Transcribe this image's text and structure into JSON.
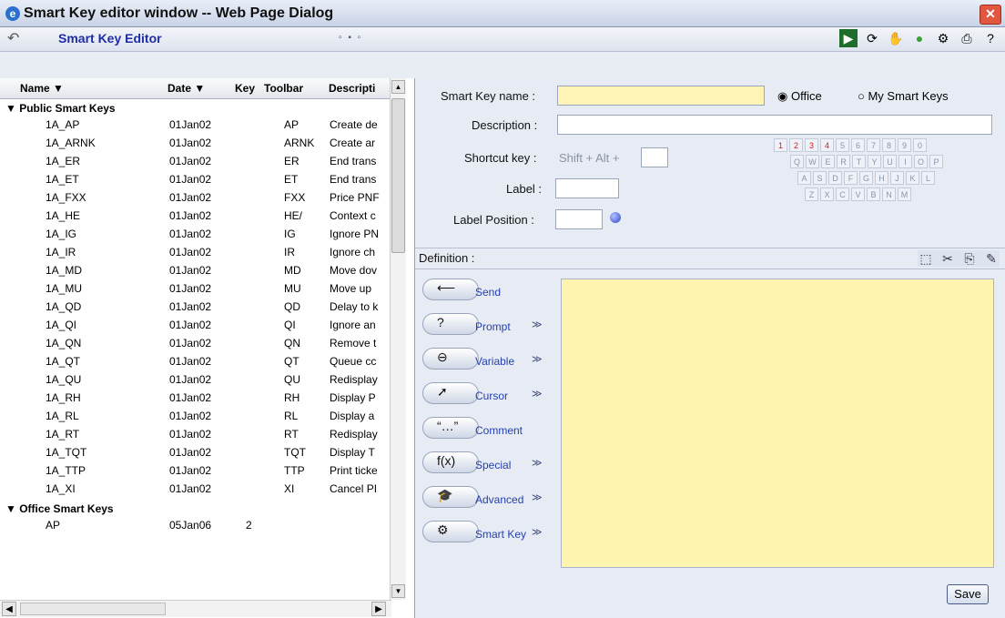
{
  "window": {
    "title": "Smart Key editor window -- Web Page Dialog",
    "close": "✕"
  },
  "toolbar": {
    "title": "Smart Key Editor",
    "layout_icon": "▫ ▪ ▫"
  },
  "table": {
    "headers": [
      "Name ▼",
      "Date ▼",
      "Key",
      "Toolbar",
      "Descripti"
    ],
    "groups": [
      {
        "label": "Public Smart Keys",
        "rows": [
          [
            "1A_AP",
            "01Jan02",
            "",
            "AP",
            "Create de"
          ],
          [
            "1A_ARNK",
            "01Jan02",
            "",
            "ARNK",
            "Create ar"
          ],
          [
            "1A_ER",
            "01Jan02",
            "",
            "ER",
            "End trans"
          ],
          [
            "1A_ET",
            "01Jan02",
            "",
            "ET",
            "End trans"
          ],
          [
            "1A_FXX",
            "01Jan02",
            "",
            "FXX",
            "Price PNF"
          ],
          [
            "1A_HE",
            "01Jan02",
            "",
            "HE/",
            "Context c"
          ],
          [
            "1A_IG",
            "01Jan02",
            "",
            "IG",
            "Ignore PN"
          ],
          [
            "1A_IR",
            "01Jan02",
            "",
            "IR",
            "Ignore ch"
          ],
          [
            "1A_MD",
            "01Jan02",
            "",
            "MD",
            "Move dov"
          ],
          [
            "1A_MU",
            "01Jan02",
            "",
            "MU",
            "Move up"
          ],
          [
            "1A_QD",
            "01Jan02",
            "",
            "QD",
            "Delay to k"
          ],
          [
            "1A_QI",
            "01Jan02",
            "",
            "QI",
            "Ignore an"
          ],
          [
            "1A_QN",
            "01Jan02",
            "",
            "QN",
            "Remove t"
          ],
          [
            "1A_QT",
            "01Jan02",
            "",
            "QT",
            "Queue cc"
          ],
          [
            "1A_QU",
            "01Jan02",
            "",
            "QU",
            "Redisplay"
          ],
          [
            "1A_RH",
            "01Jan02",
            "",
            "RH",
            "Display P"
          ],
          [
            "1A_RL",
            "01Jan02",
            "",
            "RL",
            "Display a"
          ],
          [
            "1A_RT",
            "01Jan02",
            "",
            "RT",
            "Redisplay"
          ],
          [
            "1A_TQT",
            "01Jan02",
            "",
            "TQT",
            "Display T"
          ],
          [
            "1A_TTP",
            "01Jan02",
            "",
            "TTP",
            "Print ticke"
          ],
          [
            "1A_XI",
            "01Jan02",
            "",
            "XI",
            "Cancel PI"
          ]
        ]
      },
      {
        "label": "Office Smart Keys",
        "rows": [
          [
            "AP",
            "05Jan06",
            "2",
            "",
            ""
          ]
        ]
      }
    ]
  },
  "form": {
    "name_label": "Smart Key name :",
    "radio_office": "Office",
    "radio_mine": "My Smart Keys",
    "description_label": "Description :",
    "shortcut_label": "Shortcut key :",
    "shortcut_prefix": "Shift + Alt +",
    "label_label": "Label :",
    "label_position_label": "Label Position :",
    "definition_label": "Definition :"
  },
  "keyboard": {
    "row1": [
      "1",
      "2",
      "3",
      "4",
      "5",
      "6",
      "7",
      "8",
      "9",
      "0"
    ],
    "row2": [
      "Q",
      "W",
      "E",
      "R",
      "T",
      "Y",
      "U",
      "I",
      "O",
      "P"
    ],
    "row3": [
      "A",
      "S",
      "D",
      "F",
      "G",
      "H",
      "J",
      "K",
      "L"
    ],
    "row4": [
      "Z",
      "X",
      "C",
      "V",
      "B",
      "N",
      "M"
    ],
    "used": [
      "1",
      "2",
      "3",
      "4"
    ]
  },
  "commands": [
    {
      "label": "Send",
      "glyph": "⟵",
      "chev": ""
    },
    {
      "label": "Prompt",
      "glyph": "?",
      "chev": "≫"
    },
    {
      "label": "Variable",
      "glyph": "⊖",
      "chev": "≫"
    },
    {
      "label": "Cursor",
      "glyph": "➚",
      "chev": "≫"
    },
    {
      "label": "Comment",
      "glyph": "“…”",
      "chev": ""
    },
    {
      "label": "Special",
      "glyph": "f(x)",
      "chev": "≫"
    },
    {
      "label": "Advanced",
      "glyph": "🎓",
      "chev": "≫"
    },
    {
      "label": "Smart Key",
      "glyph": "⚙",
      "chev": "≫"
    }
  ],
  "buttons": {
    "save": "Save"
  }
}
